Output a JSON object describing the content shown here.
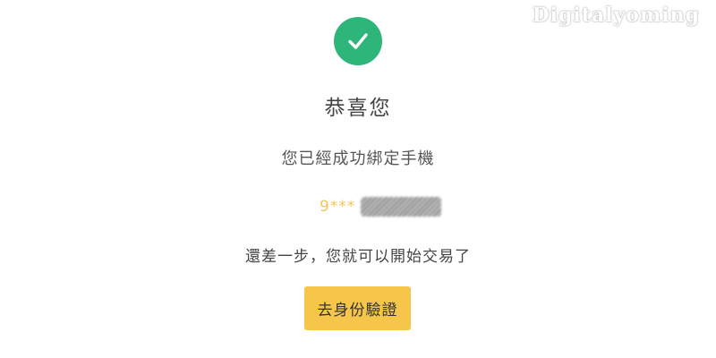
{
  "watermark": {
    "text": "Digitalyoming"
  },
  "success": {
    "icon": "check-icon",
    "color": "#2eb67a"
  },
  "title": "恭喜您",
  "subtitle": "您已經成功綁定手機",
  "phone": {
    "prefix": "9***",
    "masked": true,
    "prefix_color": "#f3c55b"
  },
  "hint": "還差一步，您就可以開始交易了",
  "action": {
    "label": "去身份驗證",
    "color": "#f6c64b"
  }
}
